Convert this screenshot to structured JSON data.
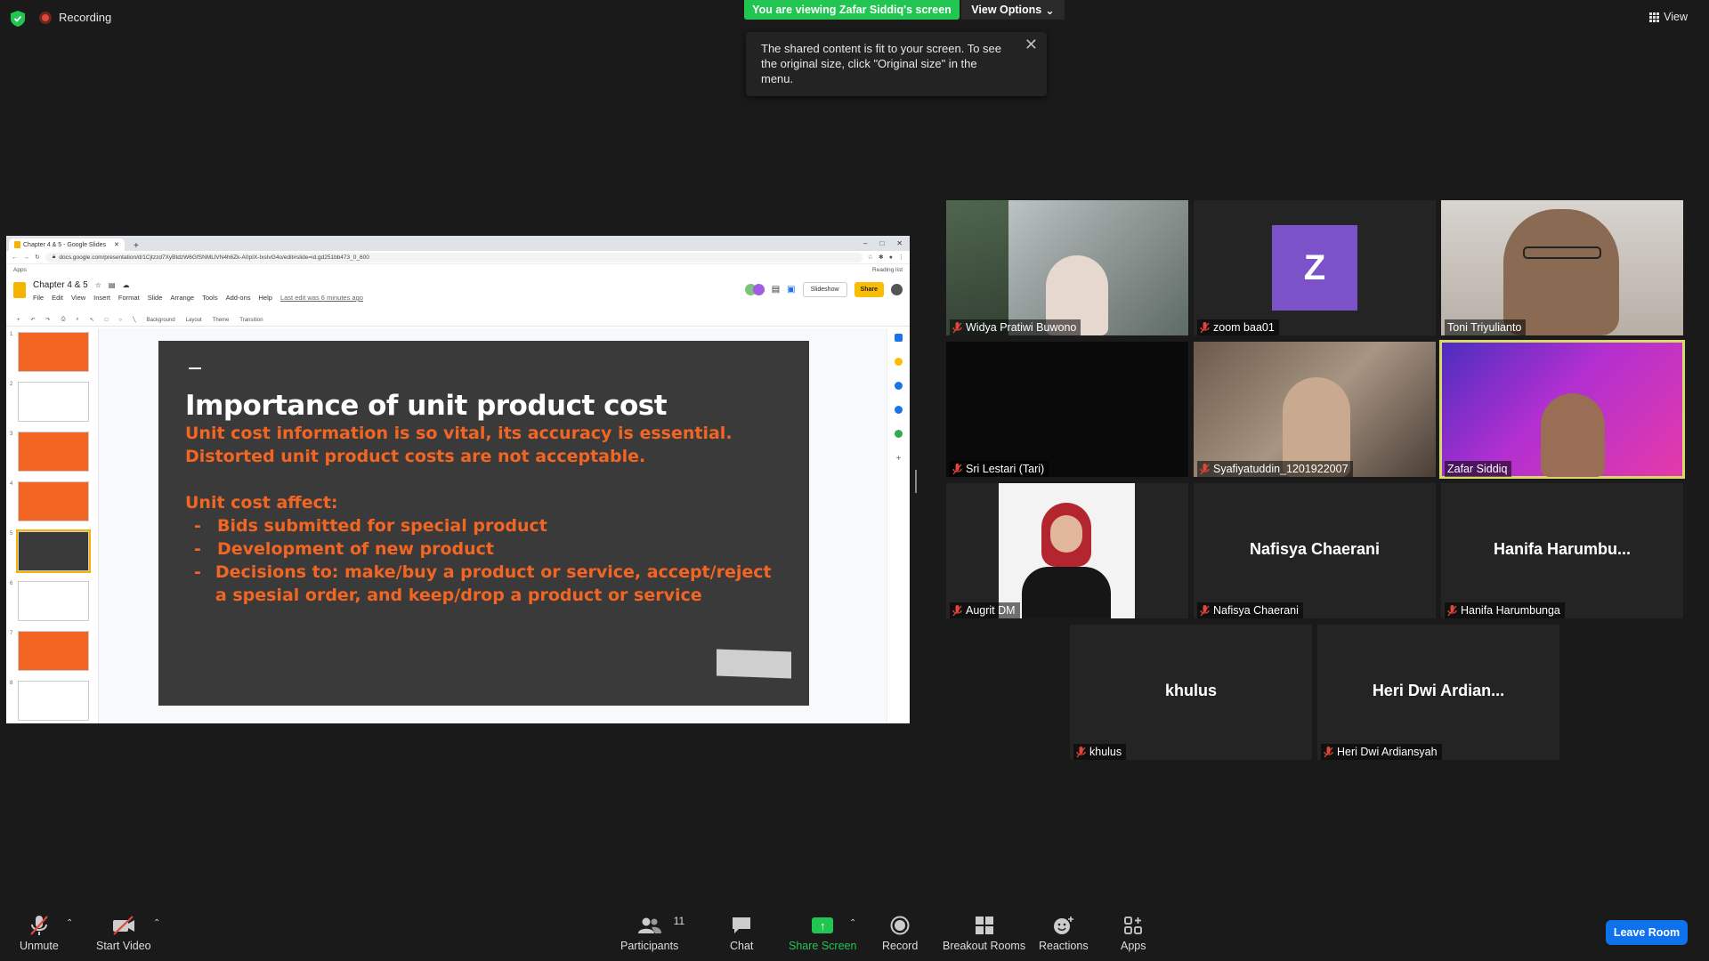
{
  "topbar": {
    "recording_label": "Recording",
    "viewing_banner": "You are viewing Zafar Siddiq's screen",
    "view_options_label": "View Options",
    "view_label": "View",
    "tooltip_text": "The shared content is fit to your screen. To see the original size, click \"Original size\" in the menu."
  },
  "browser": {
    "tab_title": "Chapter 4 & 5 - Google Slides",
    "url": "docs.google.com/presentation/d/1Cjtzzd7XyBtdzW6GfSNMLlVN4h6Zk-A0pIX-IxsIvG4o/edit#slide=id.gd251bb473_0_600",
    "bookmark_apps": "Apps",
    "reading_list": "Reading list"
  },
  "slides_app": {
    "doc_title": "Chapter 4 & 5",
    "menu": [
      "File",
      "Edit",
      "View",
      "Insert",
      "Format",
      "Slide",
      "Arrange",
      "Tools",
      "Add-ons",
      "Help"
    ],
    "last_edit": "Last edit was 6 minutes ago",
    "slideshow_label": "Slideshow",
    "share_label": "Share",
    "toolbar_items": [
      "Background",
      "Layout",
      "Theme",
      "Transition"
    ],
    "thumb_numbers": [
      "1",
      "2",
      "3",
      "4",
      "5",
      "6",
      "7",
      "8"
    ],
    "current_slide": 5
  },
  "slide": {
    "title": "Importance of unit product cost",
    "paragraph": "Unit cost information is so vital, its accuracy is essential. Distorted unit product costs are not acceptable.",
    "subheading": "Unit cost affect:",
    "bullets": [
      "Bids submitted for special product",
      "Development of new product",
      "Decisions to: make/buy a product or service, accept/reject a spesial order, and keep/drop a product or service"
    ]
  },
  "participants": [
    {
      "name": "Widya Pratiwi Buwono",
      "muted": true,
      "type": "video"
    },
    {
      "name": "zoom baa01",
      "muted": true,
      "type": "avatar",
      "initial": "Z"
    },
    {
      "name": "Toni Triyulianto",
      "muted": false,
      "type": "video"
    },
    {
      "name": "Sri Lestari (Tari)",
      "muted": true,
      "type": "video-black"
    },
    {
      "name": "Syafiyatuddin_1201922007",
      "muted": true,
      "type": "video"
    },
    {
      "name": "Zafar Siddiq",
      "muted": false,
      "type": "video",
      "active_speaker": true
    },
    {
      "name": "Augrit DM",
      "muted": true,
      "type": "photo"
    },
    {
      "name": "Nafisya Chaerani",
      "muted": true,
      "type": "name",
      "display": "Nafisya Chaerani"
    },
    {
      "name": "Hanifa Harumbunga",
      "muted": true,
      "type": "name",
      "display": "Hanifa  Harumbu..."
    },
    {
      "name": "khulus",
      "muted": true,
      "type": "name",
      "display": "khulus"
    },
    {
      "name": "Heri Dwi Ardiansyah",
      "muted": true,
      "type": "name",
      "display": "Heri Dwi Ardian..."
    }
  ],
  "bottombar": {
    "unmute": "Unmute",
    "start_video": "Start Video",
    "participants": "Participants",
    "participant_count": "11",
    "chat": "Chat",
    "share_screen": "Share Screen",
    "record": "Record",
    "breakout_rooms": "Breakout Rooms",
    "reactions": "Reactions",
    "apps": "Apps",
    "leave_room": "Leave Room"
  },
  "colors": {
    "banner_green": "#23c552",
    "leave_blue": "#0e72ed",
    "slide_orange": "#f26522",
    "avatar_purple": "#7c52c9",
    "muted_red": "#e0463a"
  }
}
